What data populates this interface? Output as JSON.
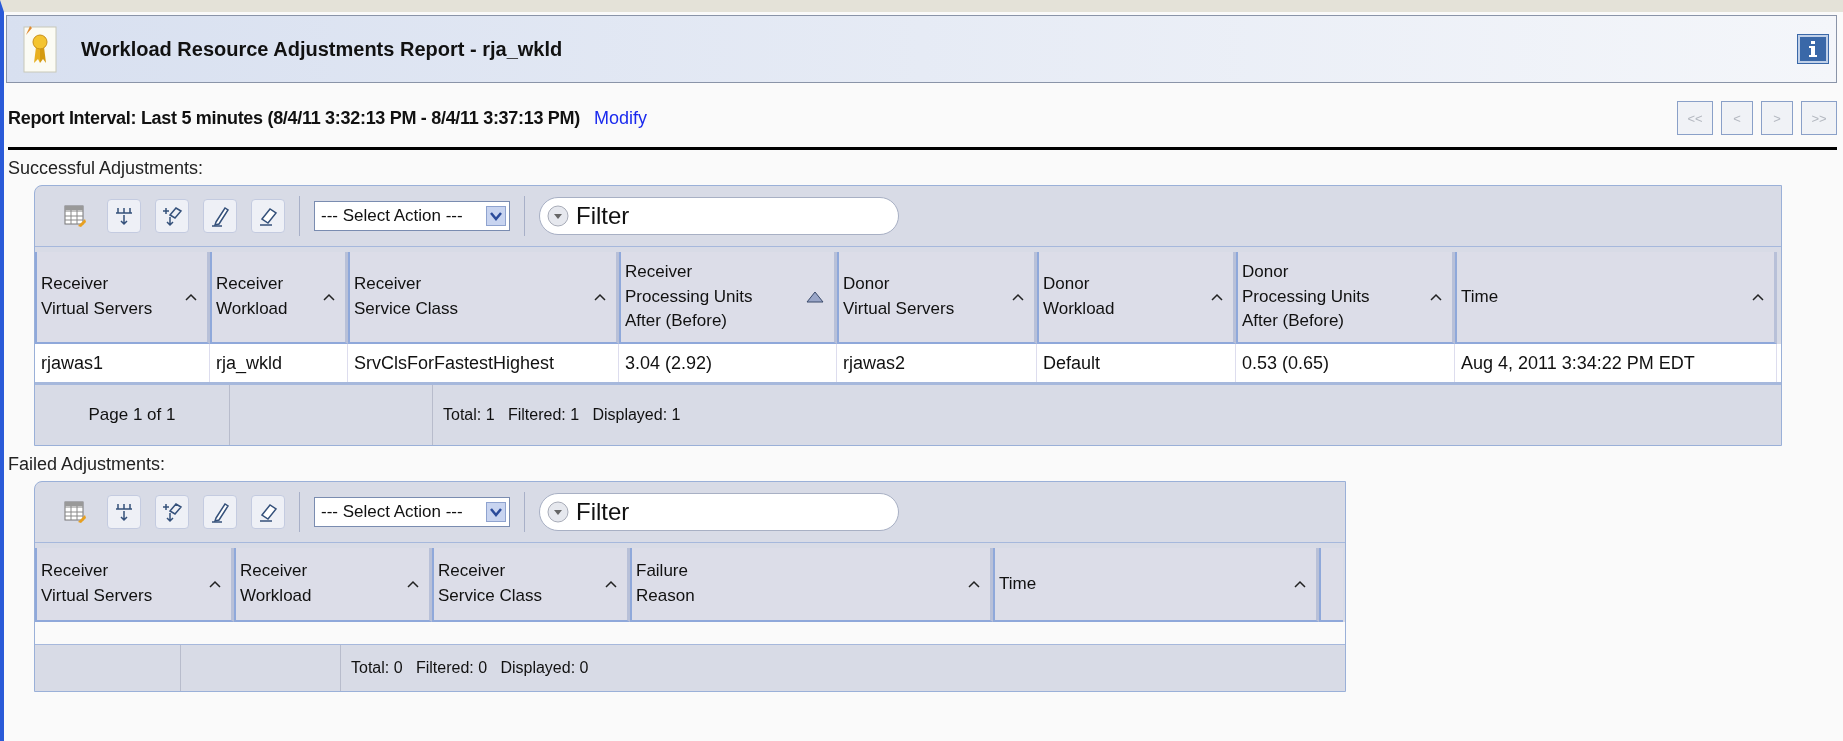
{
  "header": {
    "title": "Workload Resource Adjustments Report - rja_wkld"
  },
  "report_interval": {
    "text": "Report Interval: Last 5 minutes (8/4/11 3:32:13 PM - 8/4/11 3:37:13 PM)",
    "link": "Modify"
  },
  "pager": [
    {
      "label": "<<",
      "disabled": true
    },
    {
      "label": "<",
      "disabled": true
    },
    {
      "label": ">",
      "disabled": true
    },
    {
      "label": ">>",
      "disabled": true
    }
  ],
  "sections": [
    {
      "label": "Successful Adjustments:",
      "action_select": "--- Select Action ---",
      "filter": {
        "placeholder": "Filter"
      },
      "columns": [
        {
          "label": "Receiver\nVirtual Servers",
          "sorted": false
        },
        {
          "label": "Receiver\nWorkload",
          "sorted": false
        },
        {
          "label": "Receiver\nService Class",
          "sorted": false
        },
        {
          "label": "Receiver\nProcessing Units\nAfter (Before)",
          "sorted": true
        },
        {
          "label": "Donor\nVirtual Servers",
          "sorted": false
        },
        {
          "label": "Donor\nWorkload",
          "sorted": false
        },
        {
          "label": "Donor\nProcessing Units\nAfter (Before)",
          "sorted": false
        },
        {
          "label": "Time",
          "sorted": false
        }
      ],
      "rows": [
        [
          "rjawas1",
          "rja_wkld",
          "SrvClsForFastestHighest",
          "3.04 (2.92)",
          "rjawas2",
          "Default",
          "0.53 (0.65)",
          "Aug 4, 2011 3:34:22 PM EDT"
        ]
      ],
      "footer": {
        "page": "Page 1 of 1",
        "summary": "Total: 1   Filtered: 1   Displayed: 1"
      }
    },
    {
      "label": "Failed Adjustments:",
      "action_select": "--- Select Action ---",
      "filter": {
        "placeholder": "Filter"
      },
      "columns": [
        {
          "label": "Receiver\nVirtual Servers",
          "sorted": false
        },
        {
          "label": "Receiver\nWorkload",
          "sorted": false
        },
        {
          "label": "Receiver\nService Class",
          "sorted": false
        },
        {
          "label": "Failure\nReason",
          "sorted": false
        },
        {
          "label": "Time",
          "sorted": false
        }
      ],
      "footer": {
        "summary": "Total: 0   Filtered: 0   Displayed: 0"
      }
    }
  ]
}
